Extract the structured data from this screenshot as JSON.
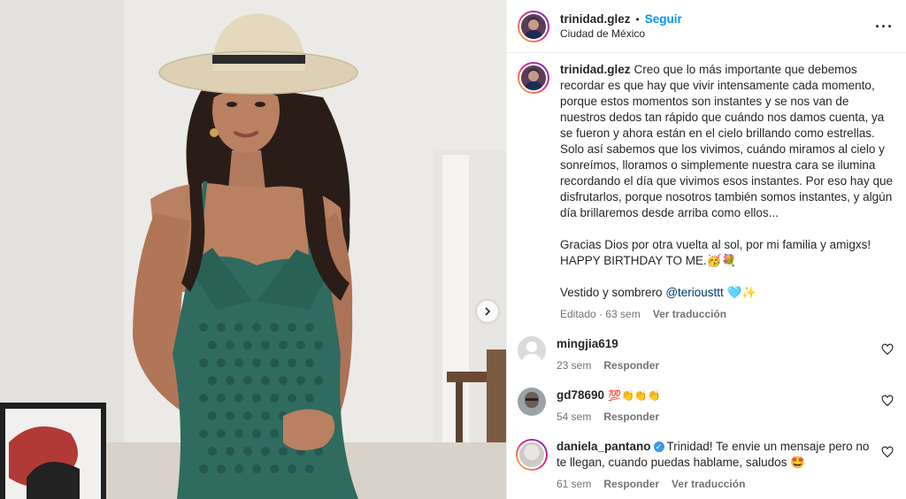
{
  "post": {
    "author": "trinidad.glez",
    "separator": "•",
    "follow_label": "Seguir",
    "location": "Ciudad de México",
    "more_icon": "more-icon"
  },
  "caption": {
    "username": "trinidad.glez",
    "paragraph1": "Creo que lo más importante que debemos recordar es que hay que vivir intensamente cada momento, porque estos momentos son instantes y se nos van de nuestros dedos tan rápido que cuándo nos damos cuenta, ya se fueron y ahora están en el cielo brillando como estrellas. Solo así sabemos que los vivimos, cuándo miramos al cielo y sonreímos, lloramos o simplemente nuestra cara se ilumina recordando el día que vivimos esos instantes. Por eso hay que disfrutarlos, porque nosotros también somos instantes, y algún día brillaremos desde arriba como ellos...",
    "paragraph2": "Gracias Dios por otra vuelta al sol, por mi familia y amigxs! HAPPY BIRTHDAY TO ME.🥳💐",
    "credits_prefix": "Vestido y sombrero ",
    "credits_mention": "@teriousttt",
    "credits_suffix": " 🩵✨",
    "edited_label": "Editado",
    "age": "63 sem",
    "translate_label": "Ver traducción"
  },
  "comments": [
    {
      "username": "mingjia619",
      "text": "",
      "age": "23 sem",
      "reply_label": "Responder"
    },
    {
      "username": "gd78690",
      "text": "💯👏👏👏",
      "age": "54 sem",
      "reply_label": "Responder"
    },
    {
      "username": "daniela_pantano",
      "verified": true,
      "text": "Trinidad! Te envie un mensaje pero no te llegan, cuando puedas hablame, saludos 🤩",
      "age": "61 sem",
      "reply_label": "Responder",
      "translate_label": "Ver traducción"
    }
  ],
  "colors": {
    "accent": "#0095f6",
    "verified": "#3897f0",
    "dress": "#2f6b5e",
    "hat": "#ddd0b4"
  }
}
